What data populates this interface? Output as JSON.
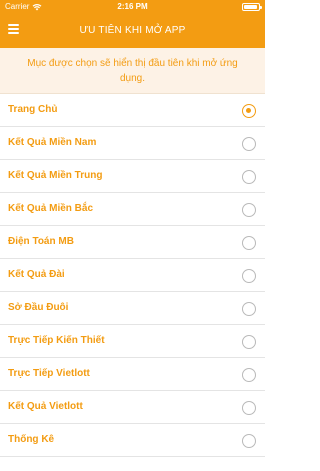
{
  "status_bar": {
    "carrier": "Carrier",
    "time": "2:16 PM",
    "wifi_icon": "wifi-icon",
    "battery_icon": "battery-icon"
  },
  "header": {
    "title": "ƯU TIÊN KHI MỞ APP",
    "menu_icon": "hamburger-menu-icon"
  },
  "banner": {
    "text": "Mục được chọn sẽ hiển thị đầu tiên khi mở ứng dụng."
  },
  "options": [
    {
      "label": "Trang Chủ",
      "selected": true
    },
    {
      "label": "Kết Quả Miền Nam",
      "selected": false
    },
    {
      "label": "Kết Quả Miền Trung",
      "selected": false
    },
    {
      "label": "Kết Quả Miền Bắc",
      "selected": false
    },
    {
      "label": "Điện Toán MB",
      "selected": false
    },
    {
      "label": "Kết Quả Đài",
      "selected": false
    },
    {
      "label": "Sở Đầu Đuôi",
      "selected": false
    },
    {
      "label": "Trực Tiếp Kiến Thiết",
      "selected": false
    },
    {
      "label": "Trực Tiếp Vietlott",
      "selected": false
    },
    {
      "label": "Kết Quả Vietlott",
      "selected": false
    },
    {
      "label": "Thống Kê",
      "selected": false
    }
  ],
  "colors": {
    "accent": "#f39c12",
    "banner_bg": "#fdf2e6",
    "divider": "#e4e4e4",
    "radio_unselected": "#b9b9b9"
  }
}
